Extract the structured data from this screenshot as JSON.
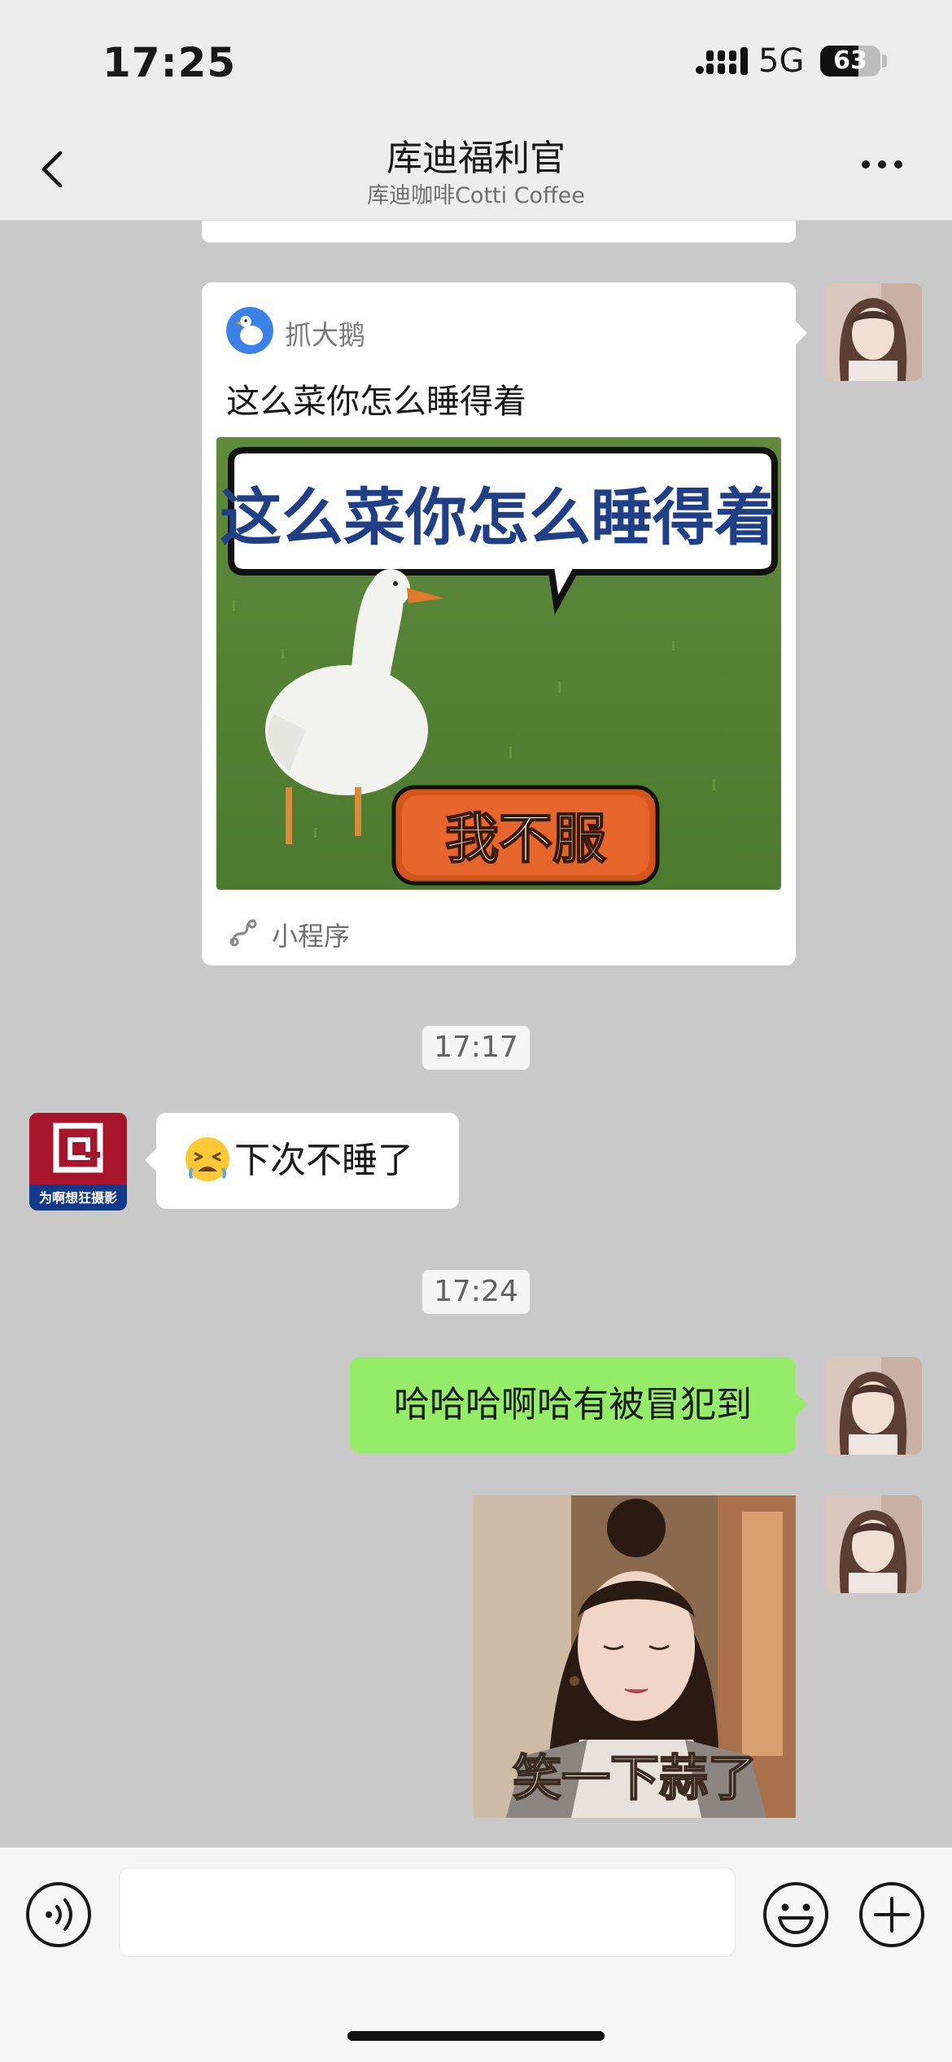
{
  "status_bar": {
    "time": "17:25",
    "network": "5G",
    "battery": "63",
    "battery_level": 0.63
  },
  "nav": {
    "title": "库迪福利官",
    "subtitle": "库迪咖啡Cotti Coffee"
  },
  "messages": {
    "mini_program": {
      "app_name": "抓大鹅",
      "title": "这么菜你怎么睡得着",
      "thumb_caption": "这么菜你怎么睡得着",
      "thumb_button": "我不服",
      "footer_label": "小程序"
    },
    "timestamp_1": "17:17",
    "incoming_avatar_text": "为啊想狂摄影",
    "incoming_text": "下次不睡了",
    "incoming_emoji": "tired-face-emoji",
    "timestamp_2": "17:24",
    "outgoing_text": "哈哈哈啊哈有被冒犯到",
    "sticker_caption": "笑一下蒜了"
  },
  "input_bar": {
    "placeholder": ""
  },
  "colors": {
    "chat_bg": "#c9c9c9",
    "outgoing_bubble": "#95ec69",
    "incoming_bubble": "#ffffff",
    "bar_bg": "#ededed"
  },
  "icons": [
    "back-icon",
    "more-icon",
    "voice-icon",
    "emoji-icon",
    "plus-icon",
    "mini-program-icon"
  ]
}
